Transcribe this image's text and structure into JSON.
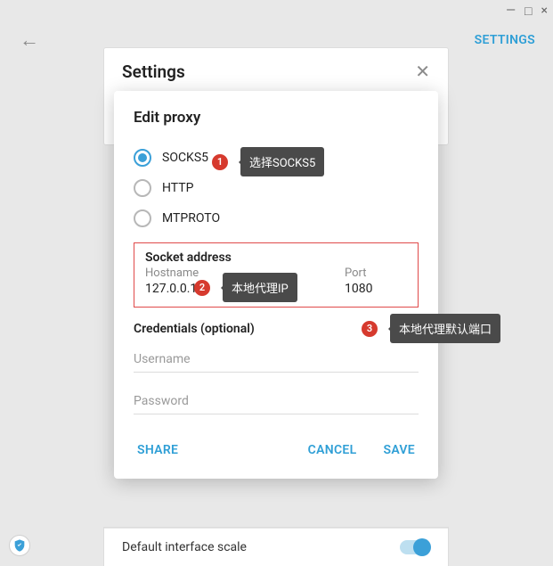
{
  "window": {
    "minimize": "—",
    "maximize": "□",
    "close": "×"
  },
  "topbar": {
    "settings_link": "SETTINGS"
  },
  "settings_panel": {
    "title": "Settings"
  },
  "modal": {
    "title": "Edit proxy",
    "radios": {
      "socks5": "SOCKS5",
      "http": "HTTP",
      "mtproto": "MTPROTO"
    },
    "socket": {
      "heading": "Socket address",
      "hostname_label": "Hostname",
      "hostname_value": "127.0.0.1",
      "port_label": "Port",
      "port_value": "1080"
    },
    "credentials": {
      "heading": "Credentials (optional)",
      "username_placeholder": "Username",
      "password_placeholder": "Password"
    },
    "actions": {
      "share": "SHARE",
      "cancel": "CANCEL",
      "save": "SAVE"
    }
  },
  "callouts": {
    "c1": {
      "num": "1",
      "text": "选择SOCKS5"
    },
    "c2": {
      "num": "2",
      "text": "本地代理IP"
    },
    "c3": {
      "num": "3",
      "text": "本地代理默认端口"
    }
  },
  "footer": {
    "scale_label": "Default interface scale"
  }
}
